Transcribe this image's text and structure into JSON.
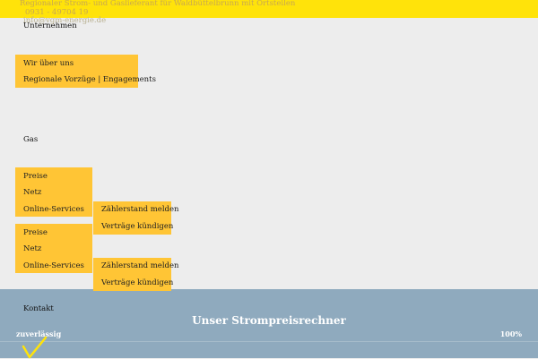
{
  "header": {
    "tagline": "Regionaler Strom- und Gaslieferant für Waldbüttelbrunn mit Ortsteilen",
    "phone": "0931 - 49704 19",
    "email": "info@vgm-energie.de"
  },
  "nav": {
    "unternehmen": {
      "label": "Unternehmen",
      "items": [
        "Wir über uns",
        "Regionale Vorzüge | Engagements"
      ]
    },
    "gas": {
      "label": "Gas",
      "items": [
        "Preise",
        "Netz",
        "Online-Services"
      ],
      "submenu": [
        "Zählerstand melden",
        "Verträge kündigen"
      ]
    },
    "strom": {
      "items": [
        "Preise",
        "Netz",
        "Online-Services"
      ],
      "submenu": [
        "Zählerstand melden",
        "Verträge kündigen"
      ]
    },
    "kontakt": {
      "label": "Kontakt"
    }
  },
  "banner": {
    "title": "Unser Strompreisrechner",
    "left_label": "zuverlässig",
    "right_label": "100%"
  },
  "colors": {
    "topbar": "#ffe30a",
    "dropdown": "#ffc535",
    "banner": "#8faabe",
    "background": "#ededed"
  }
}
